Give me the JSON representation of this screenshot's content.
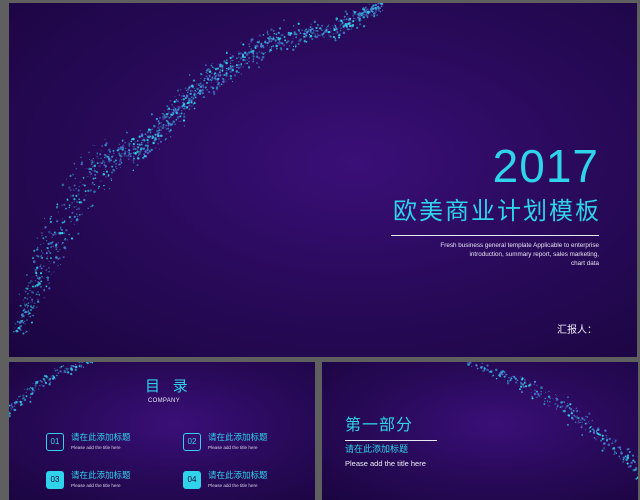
{
  "main_slide": {
    "year": "2017",
    "title": "欧美商业计划模板",
    "subtitle_lines": [
      "Fresh business general template Applicable to enterprise",
      "introduction, summary report, sales marketing,",
      "chart data"
    ],
    "reporter_label": "汇报人："
  },
  "toc_slide": {
    "title": "目 录",
    "subtitle": "COMPANY",
    "items": [
      {
        "number": "01",
        "label": "请在此添加标题",
        "en": "Please add the title here",
        "style": "outline"
      },
      {
        "number": "02",
        "label": "请在此添加标题",
        "en": "Please add the title here",
        "style": "outline"
      },
      {
        "number": "03",
        "label": "请在此添加标题",
        "en": "Please add the title here",
        "style": "filled"
      },
      {
        "number": "04",
        "label": "请在此添加标题",
        "en": "Please add the title here",
        "style": "filled"
      }
    ]
  },
  "section_slide": {
    "title": "第一部分",
    "label": "请在此添加标题",
    "en": "Please add the title here"
  },
  "colors": {
    "accent": "#2fd3ea",
    "background_dark": "#1a0540",
    "background_mid": "#3a0f78",
    "text_light": "#f0eef8",
    "frame": "#5f5f5f"
  }
}
